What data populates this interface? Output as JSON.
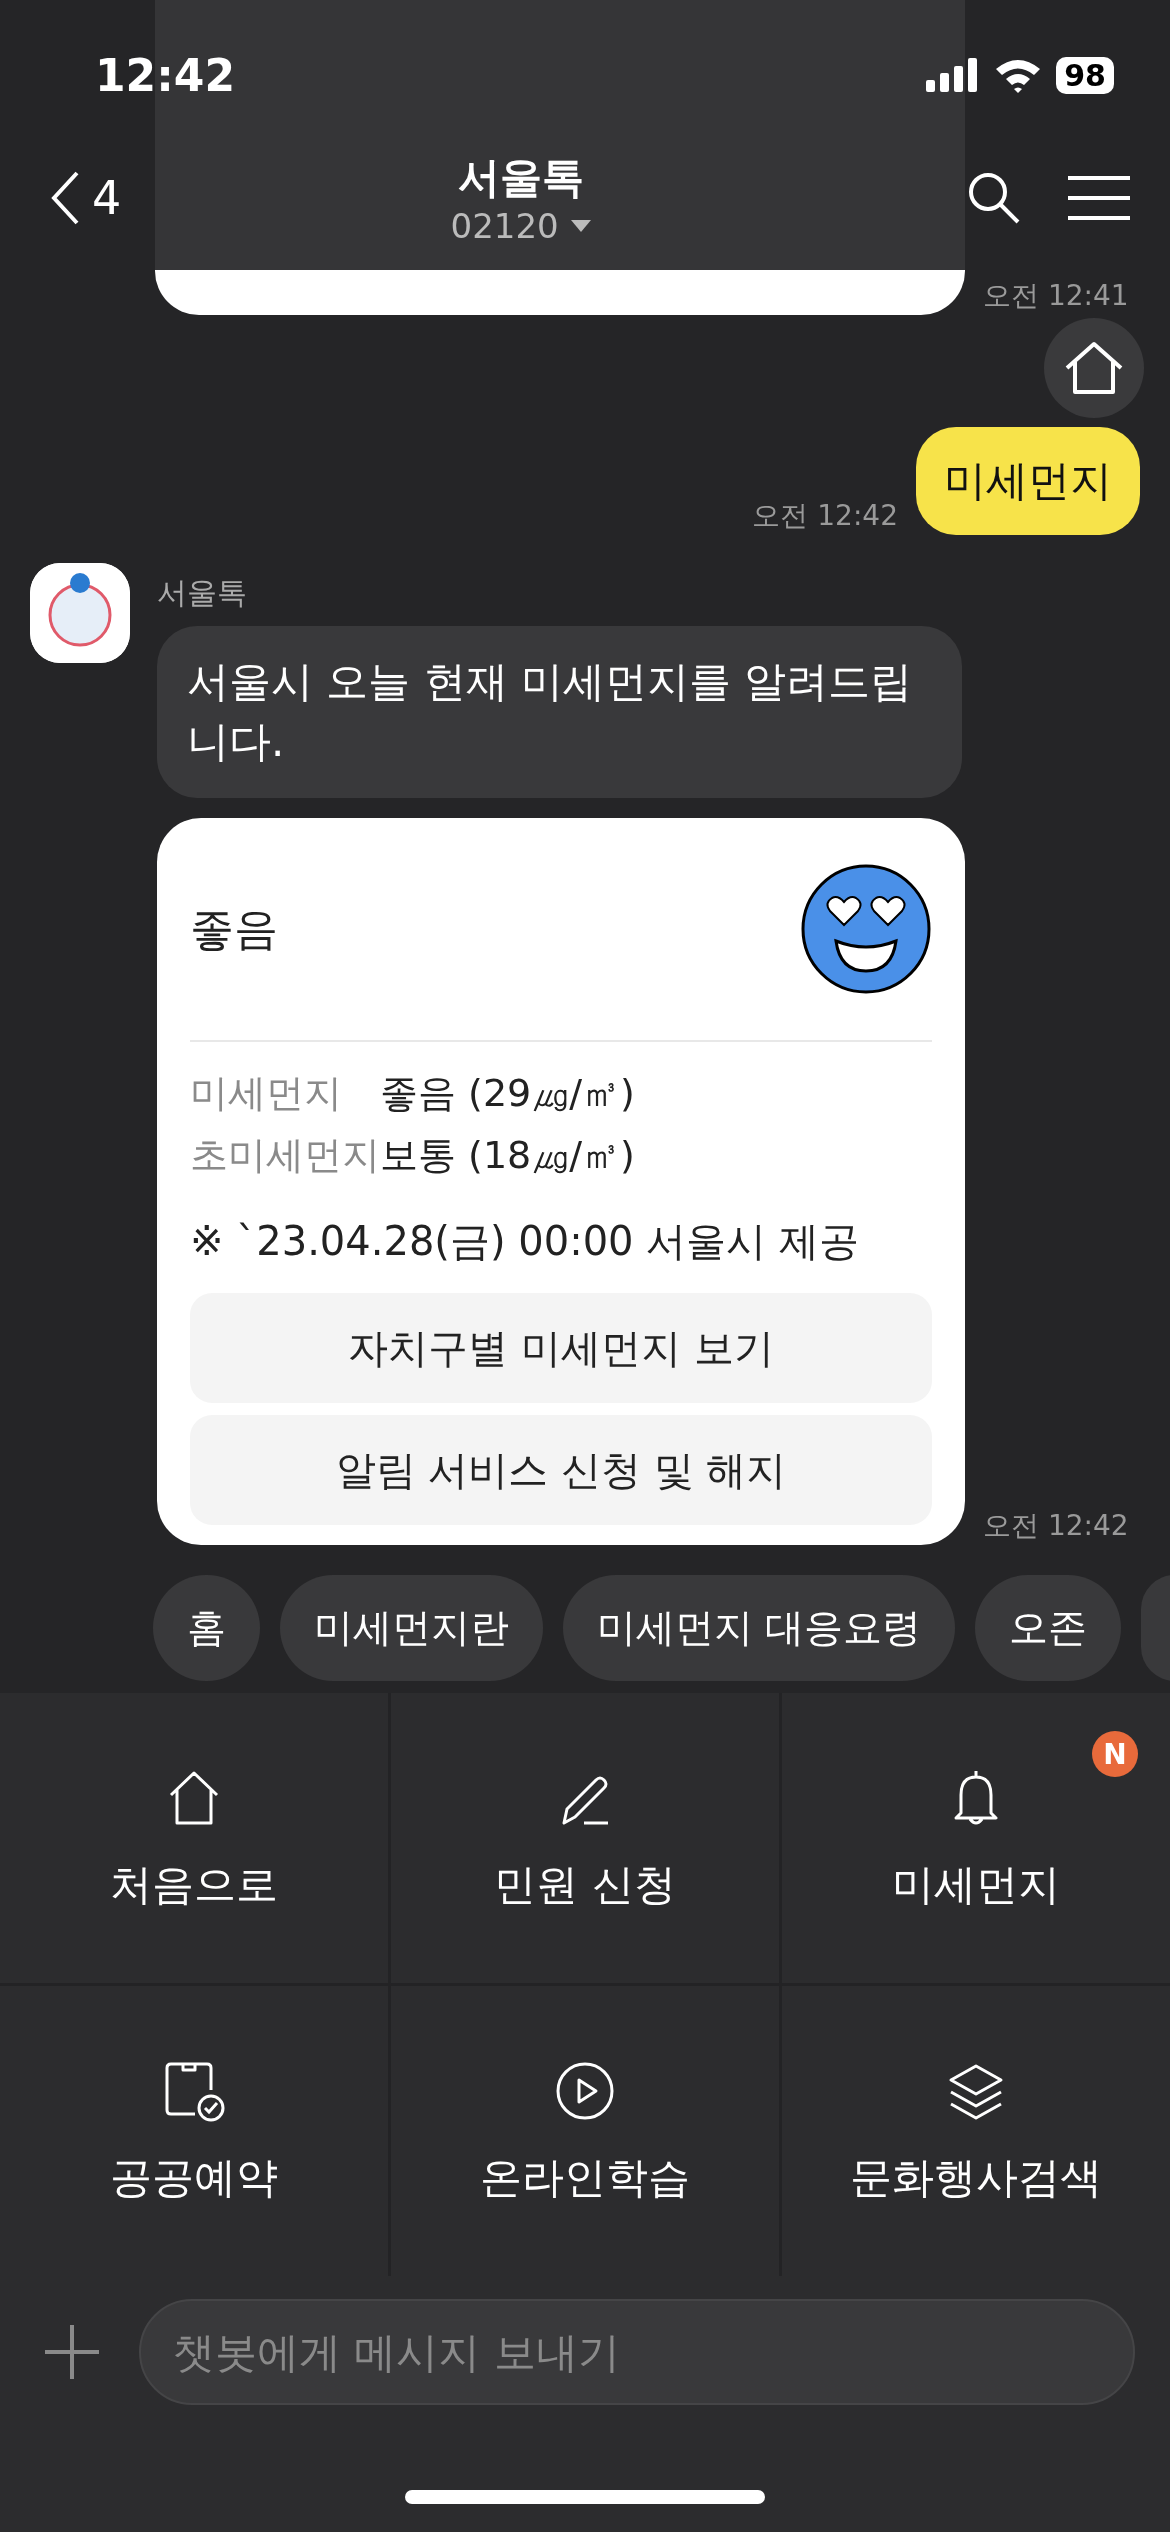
{
  "status_bar": {
    "time": "12:42",
    "battery": "98"
  },
  "header": {
    "back_count": "4",
    "title": "서울톡",
    "subtitle": "02120"
  },
  "messages": [
    {
      "kind": "cut_bubble",
      "time": "오전 12:41"
    },
    {
      "kind": "user",
      "text": "미세먼지",
      "time": "오전 12:42"
    },
    {
      "kind": "bot",
      "sender": "서울톡",
      "text": "서울시 오늘 현재 미세먼지를 알려드립니다."
    },
    {
      "kind": "card",
      "status": "좋음",
      "rows": [
        {
          "label": "미세먼지",
          "value": "좋음 (29㎍/㎥)"
        },
        {
          "label": "초미세먼지",
          "value": "보통 (18㎍/㎥)"
        }
      ],
      "note": "※ `23.04.28(금) 00:00 서울시 제공",
      "buttons": [
        "자치구별 미세먼지 보기",
        "알림 서비스 신청 및 해지"
      ],
      "time": "오전 12:42"
    }
  ],
  "quick_replies": [
    "홈",
    "미세먼지란",
    "미세먼지 대응요령",
    "오존"
  ],
  "menu": [
    {
      "label": "처음으로"
    },
    {
      "label": "민원 신청"
    },
    {
      "label": "미세먼지",
      "badge": "N"
    },
    {
      "label": "공공예약"
    },
    {
      "label": "온라인학습"
    },
    {
      "label": "문화행사검색"
    }
  ],
  "input": {
    "placeholder": "챗봇에게 메시지 보내기"
  }
}
